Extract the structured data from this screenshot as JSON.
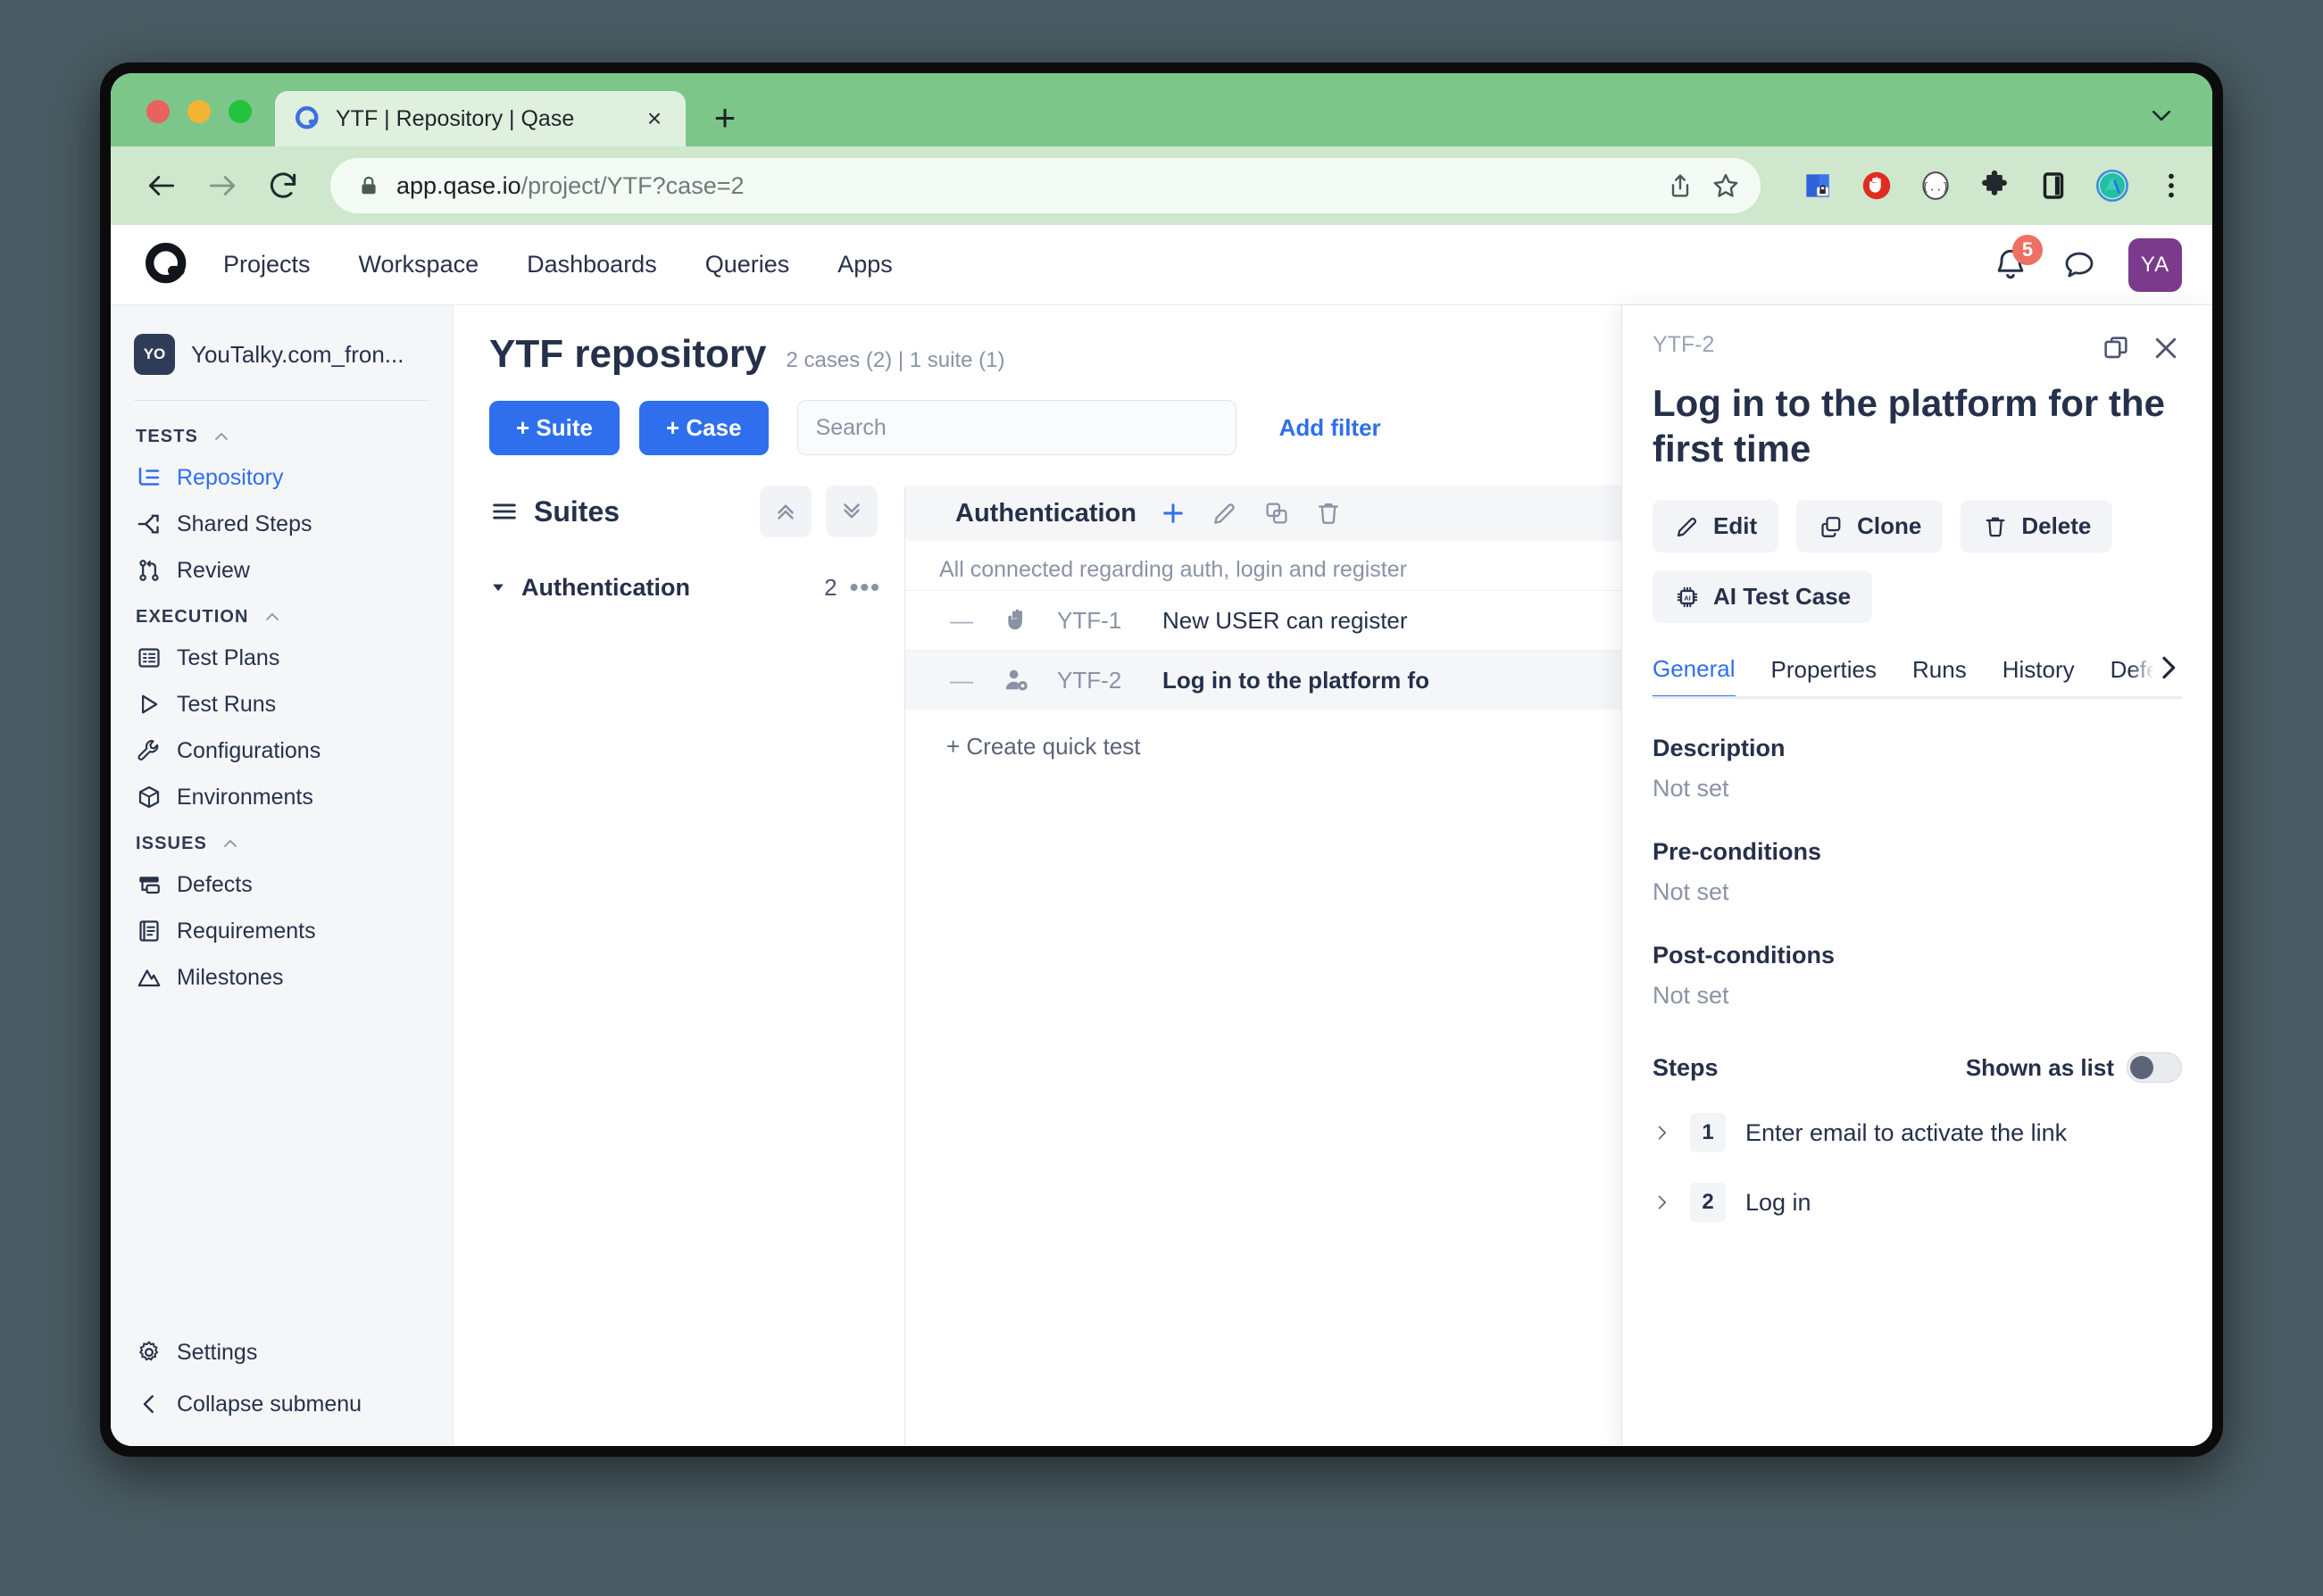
{
  "browser": {
    "tab": {
      "title": "YTF | Repository | Qase",
      "favicon": "qase-logo-icon",
      "close": "×"
    },
    "new_tab": "+",
    "url_secure": "app.qase.io",
    "url_path": "/project/YTF?case=2",
    "nav": {
      "back": "back-icon",
      "forward": "forward-icon",
      "reload": "reload-icon"
    },
    "omni_actions": [
      "share-icon",
      "bookmark-star-icon"
    ],
    "extensions": [
      "shield-lock-icon",
      "adblock-stop-hand-icon",
      "json-viewer-icon",
      "puzzle-extensions-icon",
      "side-panel-icon",
      "profile-avatar-icon",
      "chrome-menu-icon"
    ]
  },
  "app_header": {
    "logo": "qase-q-logo",
    "nav": [
      "Projects",
      "Workspace",
      "Dashboards",
      "Queries",
      "Apps"
    ],
    "notifications_count": "5",
    "avatar_initials": "YA"
  },
  "sidebar": {
    "project": {
      "badge": "YO",
      "name": "YouTalky.com_fron..."
    },
    "groups": [
      {
        "title": "TESTS",
        "items": [
          {
            "label": "Repository",
            "icon": "repository-tree-icon",
            "active": true
          },
          {
            "label": "Shared Steps",
            "icon": "shared-steps-icon",
            "active": false
          },
          {
            "label": "Review",
            "icon": "review-branch-icon",
            "active": false
          }
        ]
      },
      {
        "title": "EXECUTION",
        "items": [
          {
            "label": "Test Plans",
            "icon": "test-plans-list-icon",
            "active": false
          },
          {
            "label": "Test Runs",
            "icon": "test-runs-play-icon",
            "active": false
          },
          {
            "label": "Configurations",
            "icon": "configurations-wrench-icon",
            "active": false
          },
          {
            "label": "Environments",
            "icon": "environments-cube-icon",
            "active": false
          }
        ]
      },
      {
        "title": "ISSUES",
        "items": [
          {
            "label": "Defects",
            "icon": "defects-icon",
            "active": false
          },
          {
            "label": "Requirements",
            "icon": "requirements-book-icon",
            "active": false
          },
          {
            "label": "Milestones",
            "icon": "milestones-mountain-icon",
            "active": false
          }
        ]
      }
    ],
    "bottom": [
      {
        "label": "Settings",
        "icon": "gear-icon"
      },
      {
        "label": "Collapse submenu",
        "icon": "chevron-left-icon"
      }
    ]
  },
  "main": {
    "title": "YTF repository",
    "subtitle": "2 cases (2) | 1 suite (1)",
    "add_suite": "+ Suite",
    "add_case": "+ Case",
    "search_placeholder": "Search",
    "search_value": "",
    "add_filter": "Add filter",
    "suites": {
      "heading": "Suites",
      "collapse_all": "collapse-all-icon",
      "expand_all": "expand-all-icon",
      "items": [
        {
          "name": "Authentication",
          "count": "2",
          "menu": "•••"
        }
      ]
    },
    "cases": {
      "group_title": "Authentication",
      "group_icons": [
        "add-case-icon",
        "edit-pencil-icon",
        "clone-copy-icon",
        "delete-trash-icon"
      ],
      "group_description": "All connected regarding auth, login and register",
      "rows": [
        {
          "dash": "—",
          "type_icon": "manual-hand-icon",
          "id": "YTF-1",
          "title": "New USER can register",
          "selected": false
        },
        {
          "dash": "—",
          "type_icon": "user-settings-icon",
          "id": "YTF-2",
          "title": "Log in to the platform fo",
          "selected": true
        }
      ],
      "quick_test": "+ Create quick test"
    }
  },
  "detail": {
    "case_id": "YTF-2",
    "title": "Log in to the platform for the first time",
    "window_icon": "open-in-window-icon",
    "close_icon": "close-x-icon",
    "buttons": [
      {
        "label": "Edit",
        "icon": "edit-pencil-icon"
      },
      {
        "label": "Clone",
        "icon": "clone-copy-icon"
      },
      {
        "label": "Delete",
        "icon": "delete-trash-icon"
      },
      {
        "label": "AI Test Case",
        "icon": "ai-chip-icon"
      }
    ],
    "tabs": [
      {
        "label": "General",
        "active": true
      },
      {
        "label": "Properties",
        "active": false
      },
      {
        "label": "Runs",
        "active": false
      },
      {
        "label": "History",
        "active": false
      },
      {
        "label": "Defects",
        "active": false
      }
    ],
    "tabs_next": "chevron-right-icon",
    "fields": [
      {
        "label": "Description",
        "value": "Not set"
      },
      {
        "label": "Pre-conditions",
        "value": "Not set"
      },
      {
        "label": "Post-conditions",
        "value": "Not set"
      }
    ],
    "steps": {
      "title": "Steps",
      "toggle_label": "Shown as list",
      "toggle_on": false,
      "items": [
        {
          "num": "1",
          "text": "Enter email to activate the link"
        },
        {
          "num": "2",
          "text": "Log in"
        }
      ]
    }
  },
  "colors": {
    "browser_chrome": "#7cc68a",
    "toolbar": "#cfe7cd",
    "accent_blue": "#2f6fed",
    "text_dark": "#25304a",
    "text_muted": "#8a93a5",
    "avatar_purple": "#7b3a8c",
    "badge_red": "#ee6f63",
    "sidebar_bg": "#f5f6f8"
  }
}
